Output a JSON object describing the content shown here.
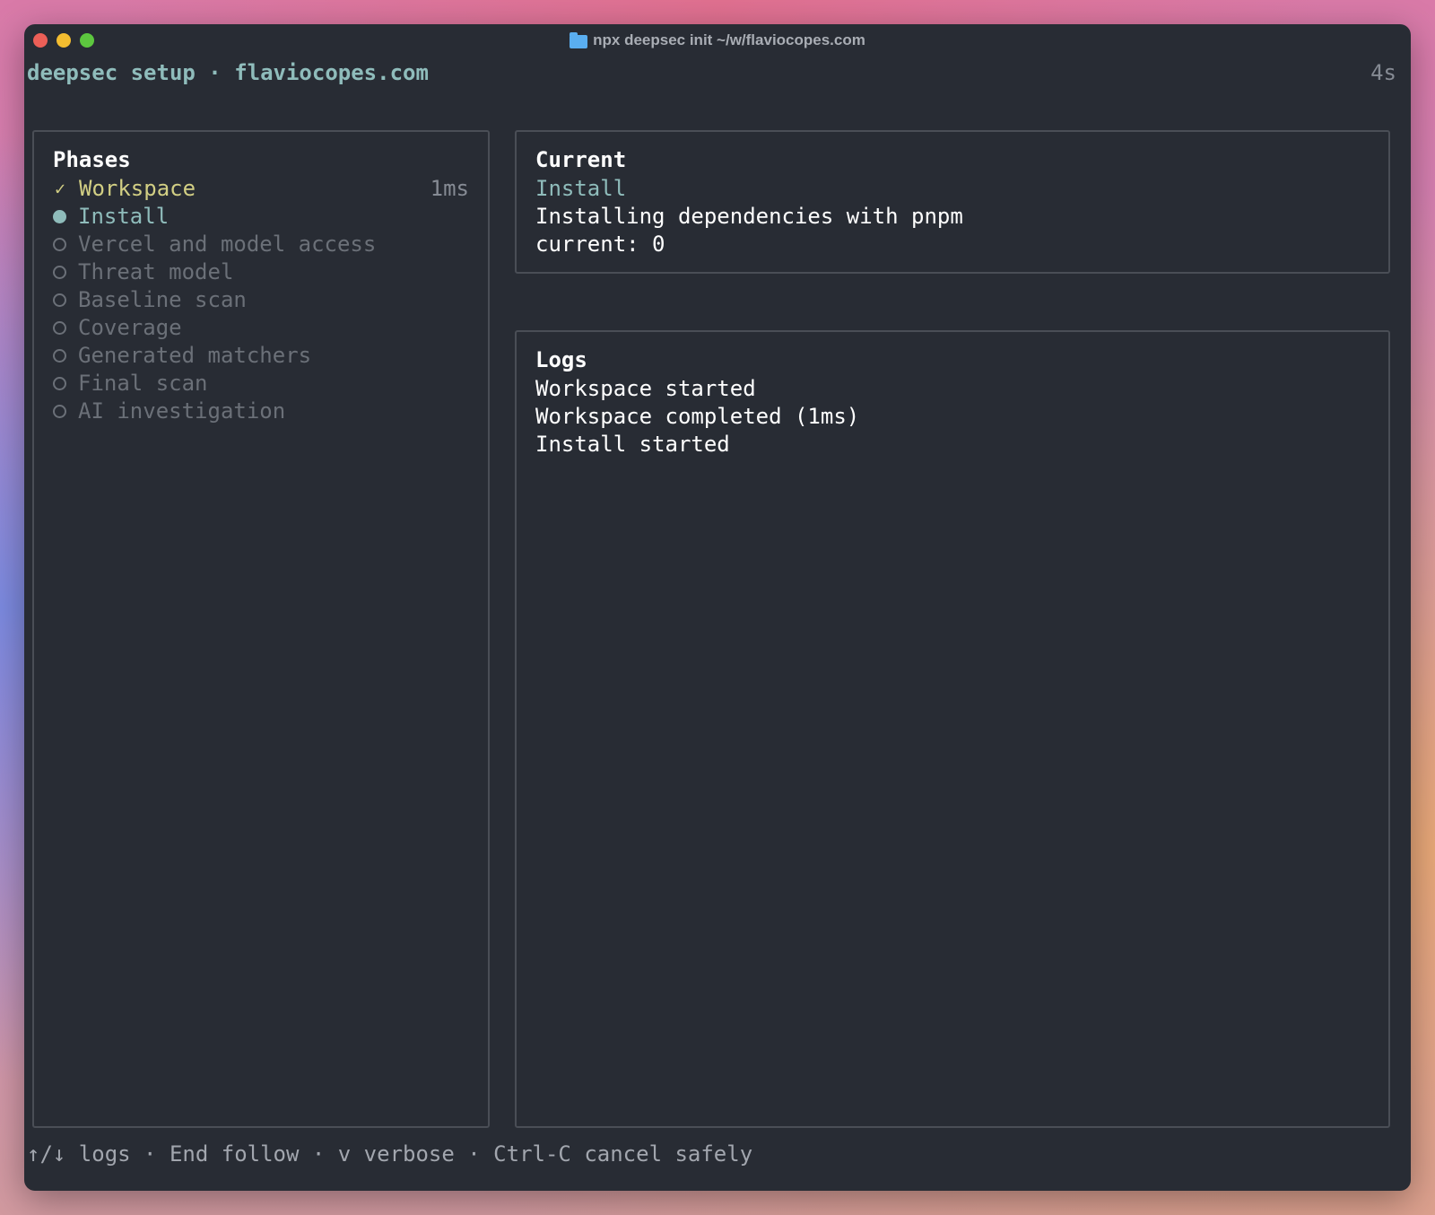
{
  "window": {
    "title": "npx deepsec init  ~/w/flaviocopes.com"
  },
  "header": {
    "title": "deepsec setup · flaviocopes.com",
    "elapsed": "4s"
  },
  "phases": {
    "title": "Phases",
    "items": [
      {
        "label": "Workspace",
        "status": "done",
        "duration": "1ms",
        "icon": "check-icon"
      },
      {
        "label": "Install",
        "status": "active",
        "duration": "",
        "icon": "filled-dot-icon"
      },
      {
        "label": "Vercel and model access",
        "status": "pending",
        "duration": "",
        "icon": "empty-circle-icon"
      },
      {
        "label": "Threat model",
        "status": "pending",
        "duration": "",
        "icon": "empty-circle-icon"
      },
      {
        "label": "Baseline scan",
        "status": "pending",
        "duration": "",
        "icon": "empty-circle-icon"
      },
      {
        "label": "Coverage",
        "status": "pending",
        "duration": "",
        "icon": "empty-circle-icon"
      },
      {
        "label": "Generated matchers",
        "status": "pending",
        "duration": "",
        "icon": "empty-circle-icon"
      },
      {
        "label": "Final scan",
        "status": "pending",
        "duration": "",
        "icon": "empty-circle-icon"
      },
      {
        "label": "AI investigation",
        "status": "pending",
        "duration": "",
        "icon": "empty-circle-icon"
      }
    ]
  },
  "current": {
    "title": "Current",
    "phase": "Install",
    "description": "Installing dependencies with pnpm",
    "counter": "current: 0"
  },
  "logs": {
    "title": "Logs",
    "lines": [
      "Workspace started",
      "Workspace completed (1ms)",
      "Install started"
    ]
  },
  "footer": {
    "hints": "↑/↓ logs · End follow · v verbose · Ctrl-C cancel safely"
  },
  "colors": {
    "background": "#282c34",
    "accent_teal": "#8fbcbb",
    "done_yellow": "#d2cf84",
    "pending_gray": "#6b7078",
    "text_white": "#ffffff",
    "close": "#ec5f57",
    "minimize": "#f4bd30",
    "zoom": "#5dc73f"
  }
}
